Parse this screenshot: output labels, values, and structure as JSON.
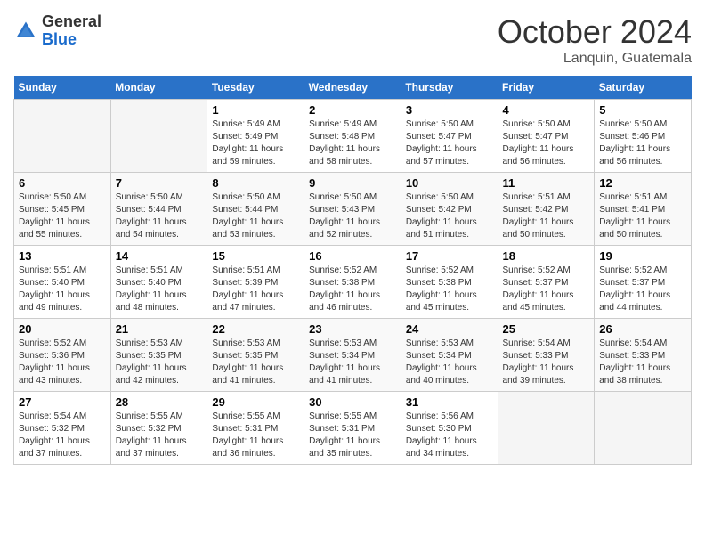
{
  "header": {
    "logo_general": "General",
    "logo_blue": "Blue",
    "month": "October 2024",
    "location": "Lanquin, Guatemala"
  },
  "weekdays": [
    "Sunday",
    "Monday",
    "Tuesday",
    "Wednesday",
    "Thursday",
    "Friday",
    "Saturday"
  ],
  "weeks": [
    [
      {
        "day": "",
        "info": ""
      },
      {
        "day": "",
        "info": ""
      },
      {
        "day": "1",
        "info": "Sunrise: 5:49 AM\nSunset: 5:49 PM\nDaylight: 11 hours and 59 minutes."
      },
      {
        "day": "2",
        "info": "Sunrise: 5:49 AM\nSunset: 5:48 PM\nDaylight: 11 hours and 58 minutes."
      },
      {
        "day": "3",
        "info": "Sunrise: 5:50 AM\nSunset: 5:47 PM\nDaylight: 11 hours and 57 minutes."
      },
      {
        "day": "4",
        "info": "Sunrise: 5:50 AM\nSunset: 5:47 PM\nDaylight: 11 hours and 56 minutes."
      },
      {
        "day": "5",
        "info": "Sunrise: 5:50 AM\nSunset: 5:46 PM\nDaylight: 11 hours and 56 minutes."
      }
    ],
    [
      {
        "day": "6",
        "info": "Sunrise: 5:50 AM\nSunset: 5:45 PM\nDaylight: 11 hours and 55 minutes."
      },
      {
        "day": "7",
        "info": "Sunrise: 5:50 AM\nSunset: 5:44 PM\nDaylight: 11 hours and 54 minutes."
      },
      {
        "day": "8",
        "info": "Sunrise: 5:50 AM\nSunset: 5:44 PM\nDaylight: 11 hours and 53 minutes."
      },
      {
        "day": "9",
        "info": "Sunrise: 5:50 AM\nSunset: 5:43 PM\nDaylight: 11 hours and 52 minutes."
      },
      {
        "day": "10",
        "info": "Sunrise: 5:50 AM\nSunset: 5:42 PM\nDaylight: 11 hours and 51 minutes."
      },
      {
        "day": "11",
        "info": "Sunrise: 5:51 AM\nSunset: 5:42 PM\nDaylight: 11 hours and 50 minutes."
      },
      {
        "day": "12",
        "info": "Sunrise: 5:51 AM\nSunset: 5:41 PM\nDaylight: 11 hours and 50 minutes."
      }
    ],
    [
      {
        "day": "13",
        "info": "Sunrise: 5:51 AM\nSunset: 5:40 PM\nDaylight: 11 hours and 49 minutes."
      },
      {
        "day": "14",
        "info": "Sunrise: 5:51 AM\nSunset: 5:40 PM\nDaylight: 11 hours and 48 minutes."
      },
      {
        "day": "15",
        "info": "Sunrise: 5:51 AM\nSunset: 5:39 PM\nDaylight: 11 hours and 47 minutes."
      },
      {
        "day": "16",
        "info": "Sunrise: 5:52 AM\nSunset: 5:38 PM\nDaylight: 11 hours and 46 minutes."
      },
      {
        "day": "17",
        "info": "Sunrise: 5:52 AM\nSunset: 5:38 PM\nDaylight: 11 hours and 45 minutes."
      },
      {
        "day": "18",
        "info": "Sunrise: 5:52 AM\nSunset: 5:37 PM\nDaylight: 11 hours and 45 minutes."
      },
      {
        "day": "19",
        "info": "Sunrise: 5:52 AM\nSunset: 5:37 PM\nDaylight: 11 hours and 44 minutes."
      }
    ],
    [
      {
        "day": "20",
        "info": "Sunrise: 5:52 AM\nSunset: 5:36 PM\nDaylight: 11 hours and 43 minutes."
      },
      {
        "day": "21",
        "info": "Sunrise: 5:53 AM\nSunset: 5:35 PM\nDaylight: 11 hours and 42 minutes."
      },
      {
        "day": "22",
        "info": "Sunrise: 5:53 AM\nSunset: 5:35 PM\nDaylight: 11 hours and 41 minutes."
      },
      {
        "day": "23",
        "info": "Sunrise: 5:53 AM\nSunset: 5:34 PM\nDaylight: 11 hours and 41 minutes."
      },
      {
        "day": "24",
        "info": "Sunrise: 5:53 AM\nSunset: 5:34 PM\nDaylight: 11 hours and 40 minutes."
      },
      {
        "day": "25",
        "info": "Sunrise: 5:54 AM\nSunset: 5:33 PM\nDaylight: 11 hours and 39 minutes."
      },
      {
        "day": "26",
        "info": "Sunrise: 5:54 AM\nSunset: 5:33 PM\nDaylight: 11 hours and 38 minutes."
      }
    ],
    [
      {
        "day": "27",
        "info": "Sunrise: 5:54 AM\nSunset: 5:32 PM\nDaylight: 11 hours and 37 minutes."
      },
      {
        "day": "28",
        "info": "Sunrise: 5:55 AM\nSunset: 5:32 PM\nDaylight: 11 hours and 37 minutes."
      },
      {
        "day": "29",
        "info": "Sunrise: 5:55 AM\nSunset: 5:31 PM\nDaylight: 11 hours and 36 minutes."
      },
      {
        "day": "30",
        "info": "Sunrise: 5:55 AM\nSunset: 5:31 PM\nDaylight: 11 hours and 35 minutes."
      },
      {
        "day": "31",
        "info": "Sunrise: 5:56 AM\nSunset: 5:30 PM\nDaylight: 11 hours and 34 minutes."
      },
      {
        "day": "",
        "info": ""
      },
      {
        "day": "",
        "info": ""
      }
    ]
  ]
}
